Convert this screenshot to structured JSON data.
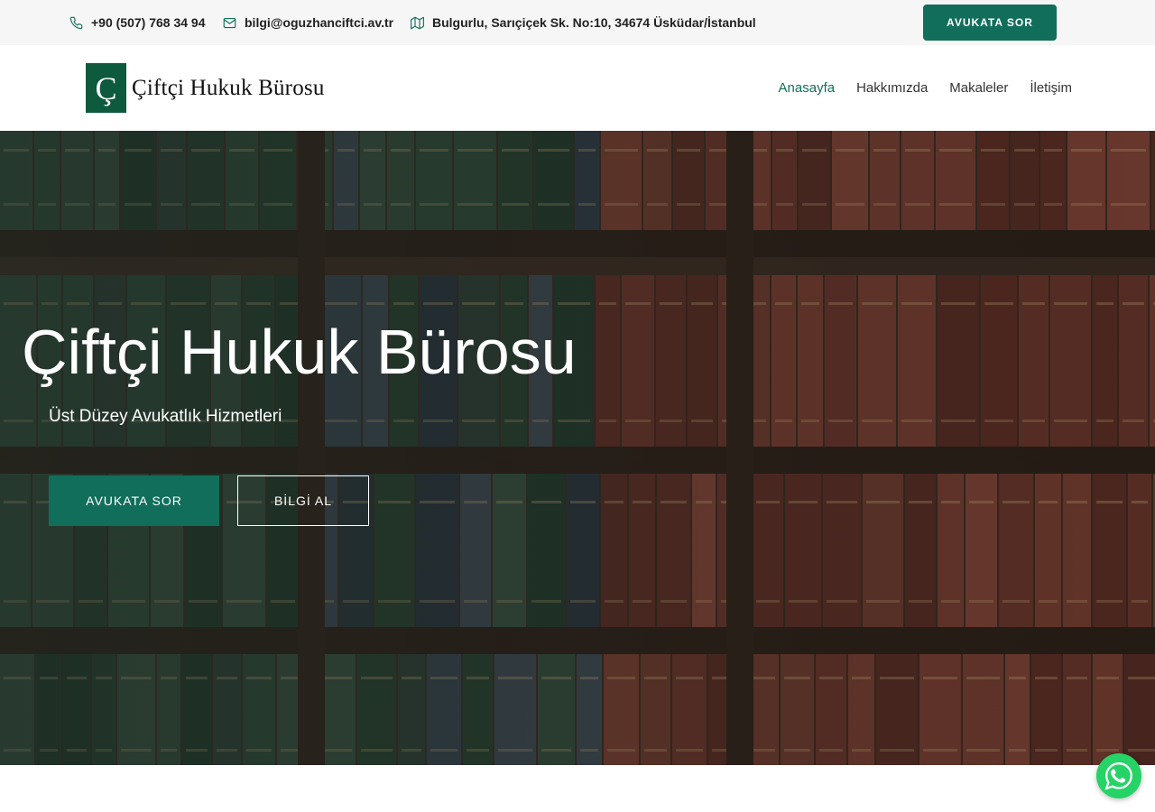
{
  "topbar": {
    "phone": "+90 (507) 768 34 94",
    "email": "bilgi@oguzhanciftci.av.tr",
    "address": "Bulgurlu, Sarıçiçek Sk. No:10, 34674 Üsküdar/İstanbul",
    "cta_label": "AVUKATA SOR"
  },
  "header": {
    "logo_mark": "Ç",
    "logo_text": "Çiftçi Hukuk Bürosu",
    "nav": [
      {
        "label": "Anasayfa",
        "active": true
      },
      {
        "label": "Hakkımızda"
      },
      {
        "label": "Makaleler"
      },
      {
        "label": "İletişim"
      }
    ]
  },
  "hero": {
    "title": "Çiftçi Hukuk Bürosu",
    "subtitle": "Üst Düzey Avukatlık Hizmetleri",
    "primary_button": "AVUKATA SOR",
    "secondary_button": "BİLGİ AL"
  },
  "colors": {
    "accent": "#116e5b",
    "logo_green": "#0e5a3f",
    "topbar_bg": "#f5f6f5",
    "whatsapp": "#25d366"
  },
  "icons": {
    "phone": "phone-icon",
    "email": "mail-icon",
    "address": "map-icon",
    "whatsapp": "whatsapp-icon"
  }
}
